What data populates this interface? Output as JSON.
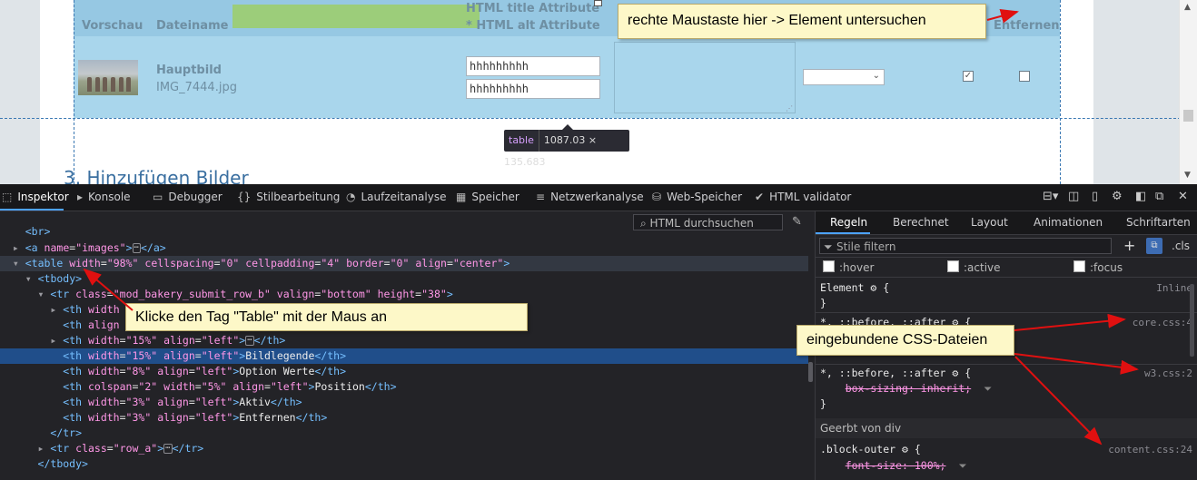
{
  "web_page": {
    "table_headers": {
      "preview": "Vorschau",
      "filename": "Dateiname",
      "title_attr": "HTML title Attribute",
      "alt_attr": "* HTML alt Attribute",
      "remove": "Entfernen"
    },
    "row": {
      "image_label": "Hauptbild",
      "filename": "IMG_7444.jpg",
      "title_value": "hhhhhhhhh",
      "alt_value": "hhhhhhhhh",
      "active_checked": true,
      "remove_checked": false
    },
    "tooltip": {
      "tag": "table",
      "dimensions": "1087.03 × 135.683"
    },
    "section_heading": "3. Hinzufügen Bilder"
  },
  "callouts": {
    "right_click": "rechte Maustaste hier -> Element untersuchen",
    "click_table": "Klicke den Tag \"Table\" mit der Maus an",
    "css_files": "eingebundene CSS-Dateien"
  },
  "devtools": {
    "tabs": [
      {
        "label": "Inspektor",
        "icon": "inspector-icon"
      },
      {
        "label": "Konsole",
        "icon": "console-icon"
      },
      {
        "label": "Debugger",
        "icon": "debugger-icon"
      },
      {
        "label": "Stilbearbeitung",
        "icon": "style-editor-icon"
      },
      {
        "label": "Laufzeitanalyse",
        "icon": "performance-icon"
      },
      {
        "label": "Speicher",
        "icon": "memory-icon"
      },
      {
        "label": "Netzwerkanalyse",
        "icon": "network-icon"
      },
      {
        "label": "Web-Speicher",
        "icon": "storage-icon"
      },
      {
        "label": "HTML validator",
        "icon": "validator-icon"
      }
    ],
    "search_placeholder": "HTML durchsuchen",
    "markup": {
      "l0": "<br>",
      "a_tag": "a",
      "a_attr": "name",
      "a_val": "images",
      "table_tag": "table",
      "table_attrs": [
        [
          "width",
          "98%"
        ],
        [
          "cellspacing",
          "0"
        ],
        [
          "cellpadding",
          "4"
        ],
        [
          "border",
          "0"
        ],
        [
          "align",
          "center"
        ]
      ],
      "tbody": "tbody",
      "tr_class": "mod_bakery_submit_row_b",
      "tr_valign": "bottom",
      "tr_height": "38",
      "th": "th",
      "th_width_label": "width",
      "th_align_label": "align",
      "th15": "15%",
      "left": "left",
      "bildlegende": "Bildlegende",
      "th8": "8%",
      "option_werte": "Option Werte",
      "colspan": "colspan",
      "colspan_val": "2",
      "th5": "5%",
      "position": "Position",
      "th3": "3%",
      "aktiv": "Aktiv",
      "entfernen": "Entfernen",
      "row_a": "row_a",
      "tr": "tr"
    },
    "rules_tabs": [
      "Regeln",
      "Berechnet",
      "Layout",
      "Animationen",
      "Schriftarten"
    ],
    "filter_placeholder": "Stile filtern",
    "cls_label": ".cls",
    "pseudo": [
      ":hover",
      ":active",
      ":focus"
    ],
    "rules": {
      "element": "Element",
      "inline": "Inline",
      "universal": "*, ::before, ::after",
      "core_src": "core.css:4",
      "w3_src": "w3.css:2",
      "box_sizing": "box-sizing: inherit;",
      "inherited": "Geerbt von div",
      "block_outer": ".block-outer",
      "content_src": "content.css:24",
      "font_size": "font-size: 100%;"
    }
  }
}
